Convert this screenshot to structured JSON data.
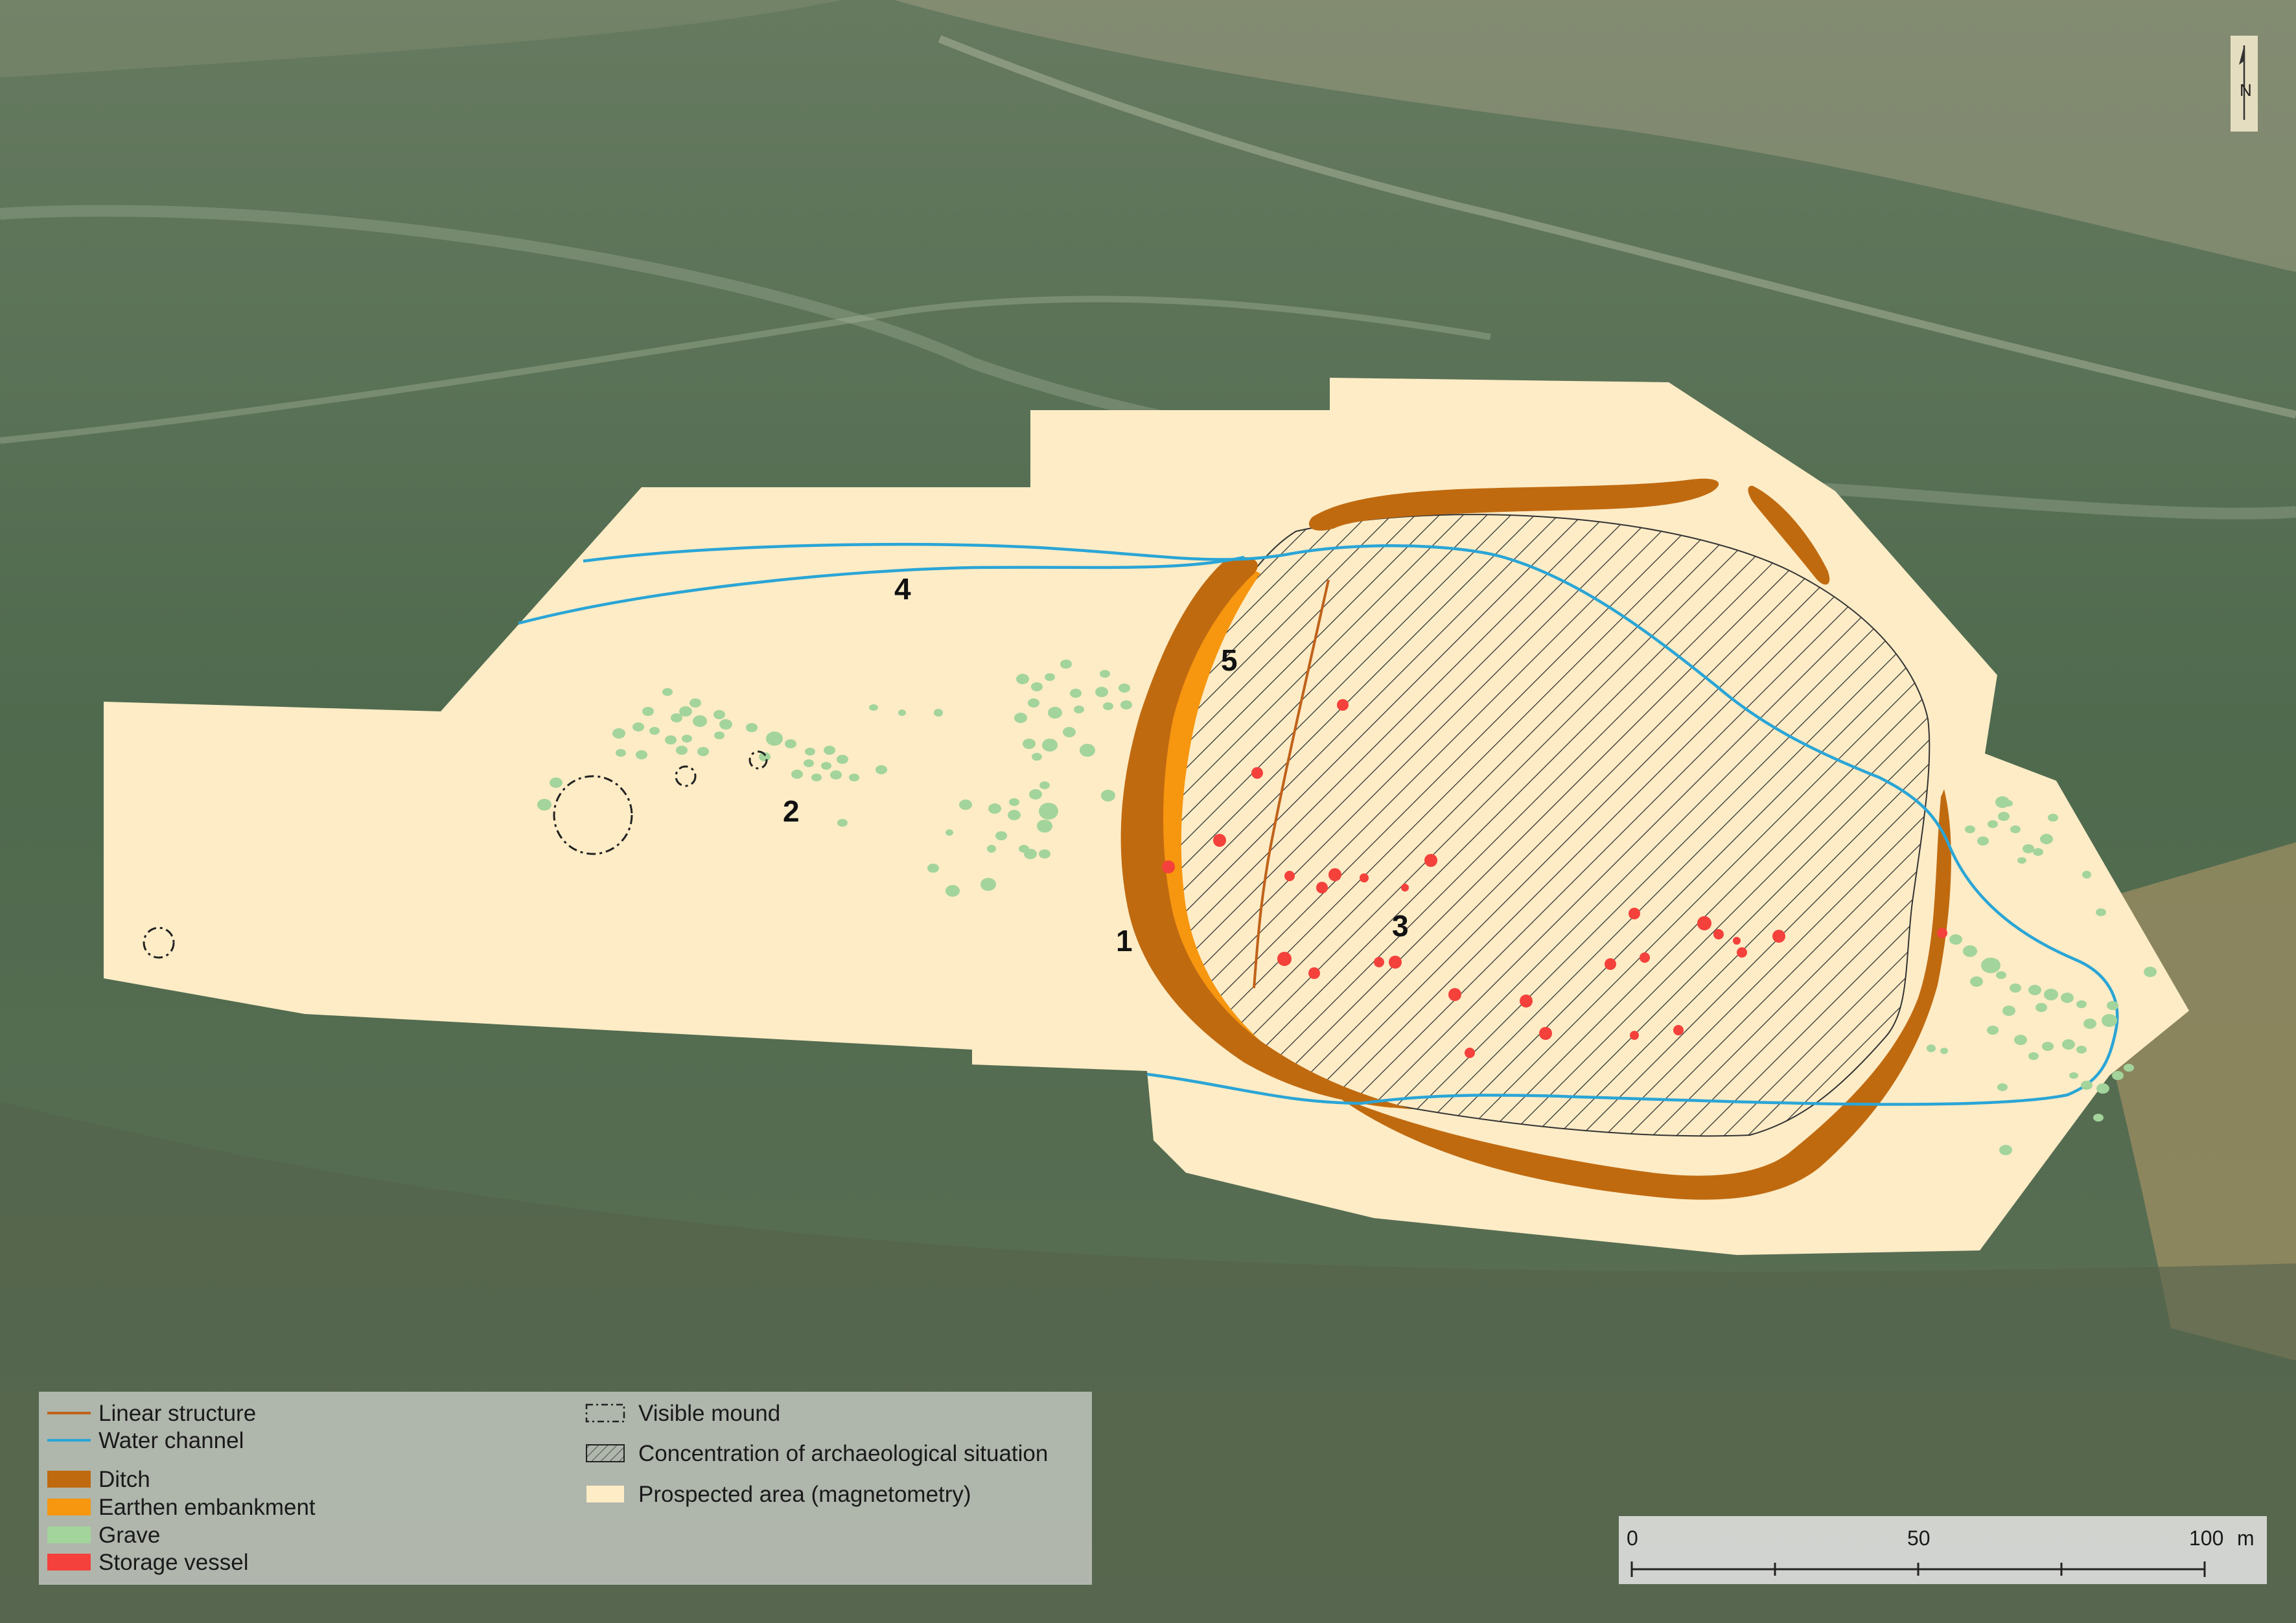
{
  "north_arrow": {
    "label": "N"
  },
  "site_labels": {
    "l1": "1",
    "l2": "2",
    "l3": "3",
    "l4": "4",
    "l5": "5"
  },
  "legend": {
    "linear_structure": "Linear structure",
    "water_channel": "Water channel",
    "ditch": "Ditch",
    "earthen_embankment": "Earthen embankment",
    "grave": "Grave",
    "storage_vessel": "Storage vessel",
    "visible_mound": "Visible mound",
    "concentration": "Concentration of archaeological situation",
    "prospected_area": "Prospected area (magnetometry)"
  },
  "scale_bar": {
    "min": "0",
    "mid": "50",
    "max": "100",
    "unit": "m"
  },
  "colors": {
    "ditch": "#c06a10",
    "embankment": "#f7960f",
    "grave": "#a3d49b",
    "storage_vessel": "#f4413b",
    "water_channel": "#2aa5d6",
    "linear_structure": "#c0621a",
    "prospected_area": "#fdecc6"
  }
}
